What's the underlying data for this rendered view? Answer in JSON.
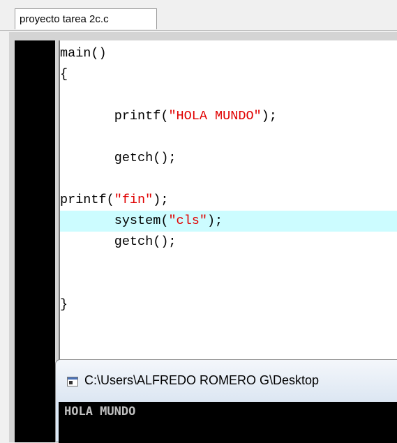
{
  "tab": {
    "label": "proyecto tarea 2c.c"
  },
  "code": {
    "lines": [
      {
        "segments": [
          {
            "text": "main()",
            "type": "plain"
          }
        ]
      },
      {
        "segments": [
          {
            "text": "{",
            "type": "plain"
          }
        ]
      },
      {
        "segments": []
      },
      {
        "segments": [
          {
            "text": "       printf(",
            "type": "plain"
          },
          {
            "text": "\"HOLA MUNDO\"",
            "type": "string"
          },
          {
            "text": ");",
            "type": "plain"
          }
        ]
      },
      {
        "segments": []
      },
      {
        "segments": [
          {
            "text": "       getch();",
            "type": "plain"
          }
        ]
      },
      {
        "segments": []
      },
      {
        "segments": [
          {
            "text": "printf(",
            "type": "plain"
          },
          {
            "text": "\"fin\"",
            "type": "string"
          },
          {
            "text": ");",
            "type": "plain"
          }
        ]
      },
      {
        "segments": [
          {
            "text": "       system(",
            "type": "plain"
          },
          {
            "text": "\"cls\"",
            "type": "string"
          },
          {
            "text": ");",
            "type": "plain"
          }
        ],
        "highlighted": true
      },
      {
        "segments": [
          {
            "text": "       getch();",
            "type": "plain"
          }
        ]
      },
      {
        "segments": []
      },
      {
        "segments": []
      },
      {
        "segments": [
          {
            "text": "}",
            "type": "plain"
          }
        ]
      }
    ]
  },
  "console": {
    "title": "C:\\Users\\ALFREDO ROMERO G\\Desktop",
    "output": "HOLA MUNDO"
  },
  "colors": {
    "string": "#e00000",
    "highlight": "#ccfcff",
    "gutter": "#000000"
  }
}
